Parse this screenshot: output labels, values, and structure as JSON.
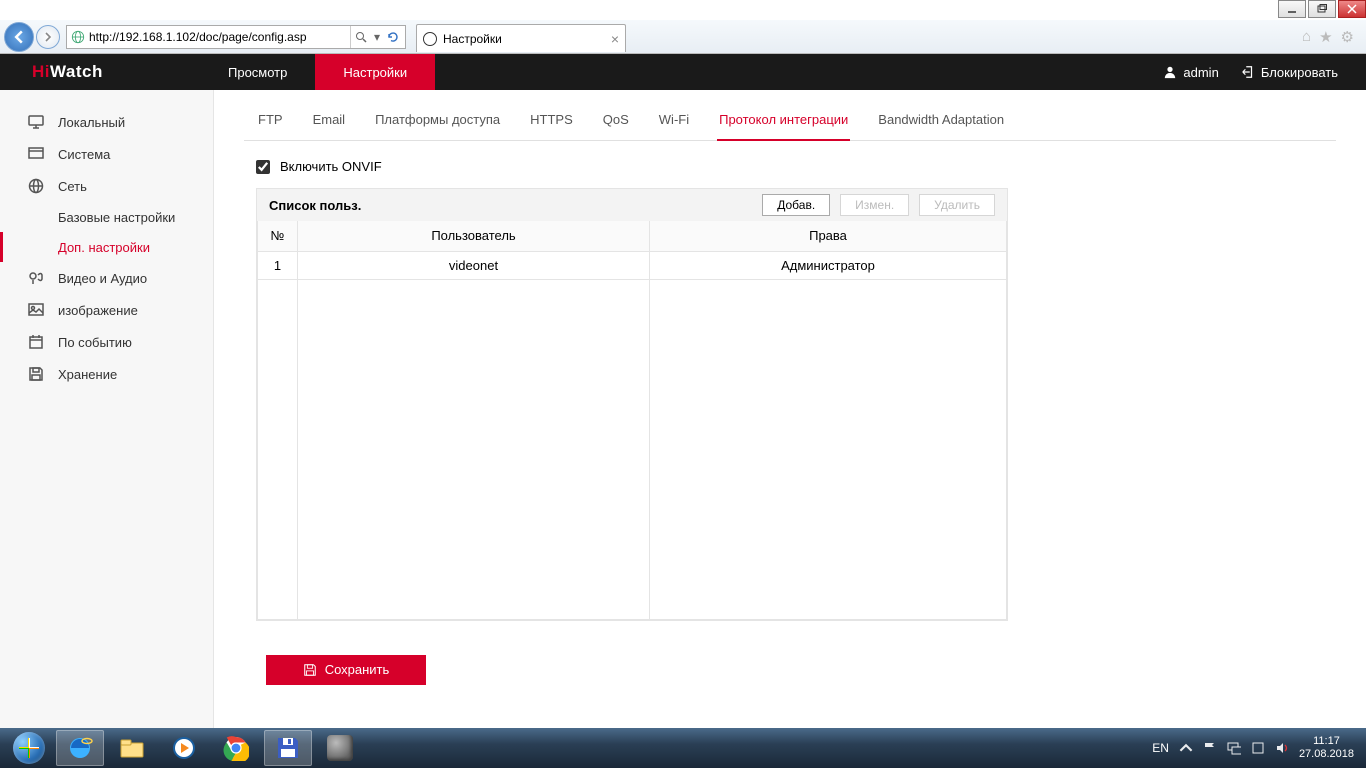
{
  "window": {
    "tab_title": "Настройки"
  },
  "browser": {
    "url": "http://192.168.1.102/doc/page/config.asp"
  },
  "app": {
    "logo": {
      "part1": "Hi",
      "part2": "Watch"
    },
    "topnav": {
      "live": "Просмотр",
      "config": "Настройки"
    },
    "user": {
      "name": "admin",
      "logout": "Блокировать"
    },
    "sidebar": {
      "local": "Локальный",
      "system": "Система",
      "network": "Сеть",
      "net_basic": "Базовые настройки",
      "net_adv": "Доп. настройки",
      "va": "Видео и Аудио",
      "image": "изображение",
      "event": "По событию",
      "storage": "Хранение"
    },
    "subtabs": {
      "ftp": "FTP",
      "email": "Email",
      "platform": "Платформы доступа",
      "https": "HTTPS",
      "qos": "QoS",
      "wifi": "Wi-Fi",
      "integration": "Протокол интеграции",
      "bw": "Bandwidth Adaptation"
    },
    "onvif_label": "Включить ONVIF",
    "userlist": {
      "title": "Список польз.",
      "add": "Добав.",
      "edit": "Измен.",
      "delete": "Удалить",
      "cols": {
        "no": "№",
        "user": "Пользователь",
        "rights": "Права"
      },
      "rows": [
        {
          "no": "1",
          "user": "videonet",
          "rights": "Администратор"
        }
      ]
    },
    "save": "Сохранить"
  },
  "taskbar": {
    "lang": "EN",
    "time": "11:17",
    "date": "27.08.2018"
  }
}
